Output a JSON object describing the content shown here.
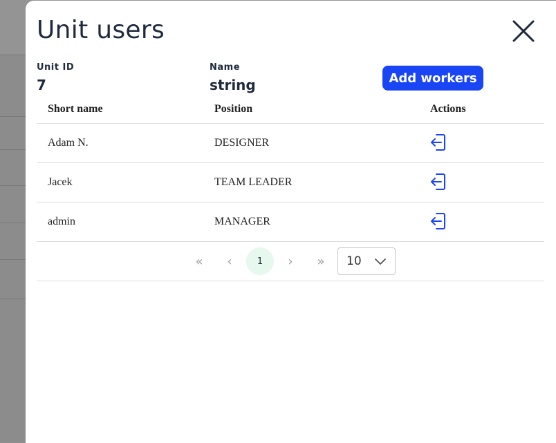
{
  "modal": {
    "title": "Unit users",
    "unit_id_label": "Unit ID",
    "unit_id_value": "7",
    "name_label": "Name",
    "name_value": "string",
    "add_button_label": "Add workers"
  },
  "table": {
    "headers": [
      "Short name",
      "Position",
      "Actions"
    ],
    "rows": [
      {
        "short_name": "Adam N.",
        "position": "DESIGNER"
      },
      {
        "short_name": "Jacek",
        "position": "TEAM LEADER"
      },
      {
        "short_name": "admin",
        "position": "MANAGER"
      }
    ]
  },
  "pagination": {
    "first": "«",
    "prev": "‹",
    "current_page": "1",
    "next": "›",
    "last": "»",
    "page_size": "10"
  },
  "icons": {
    "close": "close-icon",
    "action": "leave-unit-icon",
    "page_size_chevron": "chevron-down-icon"
  },
  "colors": {
    "primary_button": "#1a45f5",
    "action_icon": "#1a45f5",
    "current_page_bg": "#e7f8ee",
    "title_text": "#1f2a3c"
  }
}
